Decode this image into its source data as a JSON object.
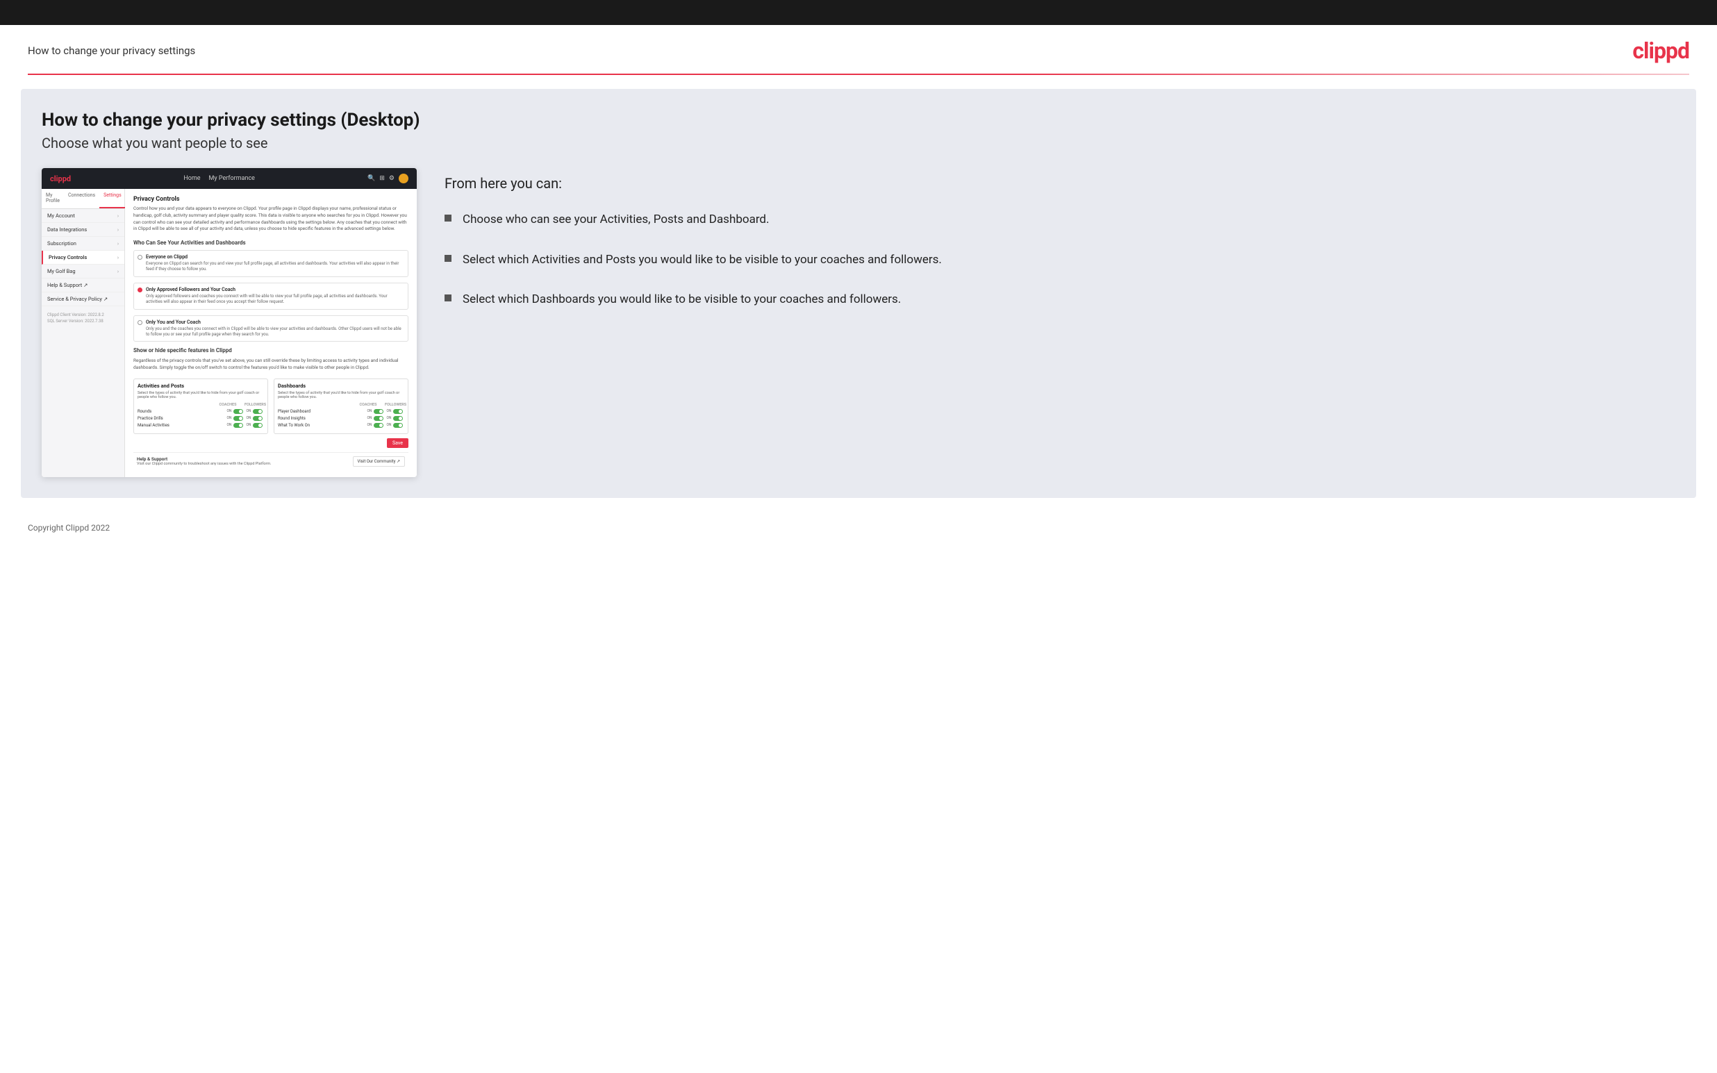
{
  "topBar": {},
  "header": {
    "title": "How to change your privacy settings",
    "logo": "clippd"
  },
  "main": {
    "heading": "How to change your privacy settings (Desktop)",
    "subheading": "Choose what you want people to see",
    "rightPanel": {
      "fromHereTitle": "From here you can:",
      "bullets": [
        "Choose who can see your Activities, Posts and Dashboard.",
        "Select which Activities and Posts you would like to be visible to your coaches and followers.",
        "Select which Dashboards you would like to be visible to your coaches and followers."
      ]
    }
  },
  "mockup": {
    "navbar": {
      "logo": "clippd",
      "links": [
        "Home",
        "My Performance"
      ],
      "icons": [
        "search",
        "grid",
        "settings",
        "avatar"
      ]
    },
    "sidebar": {
      "tabs": [
        "My Profile",
        "Connections",
        "Settings"
      ],
      "activeTab": "Settings",
      "items": [
        {
          "label": "My Account",
          "hasArrow": true
        },
        {
          "label": "Data Integrations",
          "hasArrow": true
        },
        {
          "label": "Subscription",
          "hasArrow": true
        },
        {
          "label": "Privacy Controls",
          "hasArrow": true,
          "active": true
        },
        {
          "label": "My Golf Bag",
          "hasArrow": true
        },
        {
          "label": "Help & Support",
          "hasArrow": false,
          "externalLink": true
        },
        {
          "label": "Service & Privacy Policy",
          "hasArrow": false,
          "externalLink": true
        }
      ],
      "version": "Clippd Client Version: 2022.8.2\nSQL Server Version: 2022.7.38"
    },
    "main": {
      "sectionTitle": "Privacy Controls",
      "sectionDesc": "Control how you and your data appears to everyone on Clippd. Your profile page in Clippd displays your name, professional status or handicap, golf club, activity summary and player quality score. This data is visible to anyone who searches for you in Clippd. However you can control who can see your detailed activity and performance dashboards using the settings below. Any coaches that you connect with in Clippd will be able to see all of your activity and data, unless you choose to hide specific features in the advanced settings below.",
      "whoCanSeeTitle": "Who Can See Your Activities and Dashboards",
      "radioOptions": [
        {
          "label": "Everyone on Clippd",
          "desc": "Everyone on Clippd can search for you and view your full profile page, all activities and dashboards. Your activities will also appear in their feed if they choose to follow you.",
          "selected": false
        },
        {
          "label": "Only Approved Followers and Your Coach",
          "desc": "Only approved followers and coaches you connect with will be able to view your full profile page, all activities and dashboards. Your activities will also appear in their feed once you accept their follow request.",
          "selected": true
        },
        {
          "label": "Only You and Your Coach",
          "desc": "Only you and the coaches you connect with in Clippd will be able to view your activities and dashboards. Other Clippd users will not be able to follow you or see your full profile page when they search for you.",
          "selected": false
        }
      ],
      "showHideTitle": "Show or hide specific features in Clippd",
      "showHideDesc": "Regardless of the privacy controls that you've set above, you can still override these by limiting access to activity types and individual dashboards. Simply toggle the on/off switch to control the features you'd like to make visible to other people in Clippd.",
      "activitiesBox": {
        "title": "Activities and Posts",
        "desc": "Select the types of activity that you'd like to hide from your golf coach or people who follow you.",
        "colLabels": [
          "COACHES",
          "FOLLOWERS"
        ],
        "rows": [
          {
            "label": "Rounds",
            "coachOn": true,
            "followerOn": true
          },
          {
            "label": "Practice Drills",
            "coachOn": true,
            "followerOn": true
          },
          {
            "label": "Manual Activities",
            "coachOn": true,
            "followerOn": true
          }
        ]
      },
      "dashboardsBox": {
        "title": "Dashboards",
        "desc": "Select the types of activity that you'd like to hide from your golf coach or people who follow you.",
        "colLabels": [
          "COACHES",
          "FOLLOWERS"
        ],
        "rows": [
          {
            "label": "Player Dashboard",
            "coachOn": true,
            "followerOn": true
          },
          {
            "label": "Round Insights",
            "coachOn": true,
            "followerOn": true
          },
          {
            "label": "What To Work On",
            "coachOn": true,
            "followerOn": true
          }
        ]
      },
      "saveButton": "Save",
      "helpSection": {
        "title": "Help & Support",
        "desc": "Visit our Clippd community to troubleshoot any issues with the Clippd Platform.",
        "buttonLabel": "Visit Our Community"
      }
    }
  },
  "footer": {
    "copyright": "Copyright Clippd 2022"
  }
}
